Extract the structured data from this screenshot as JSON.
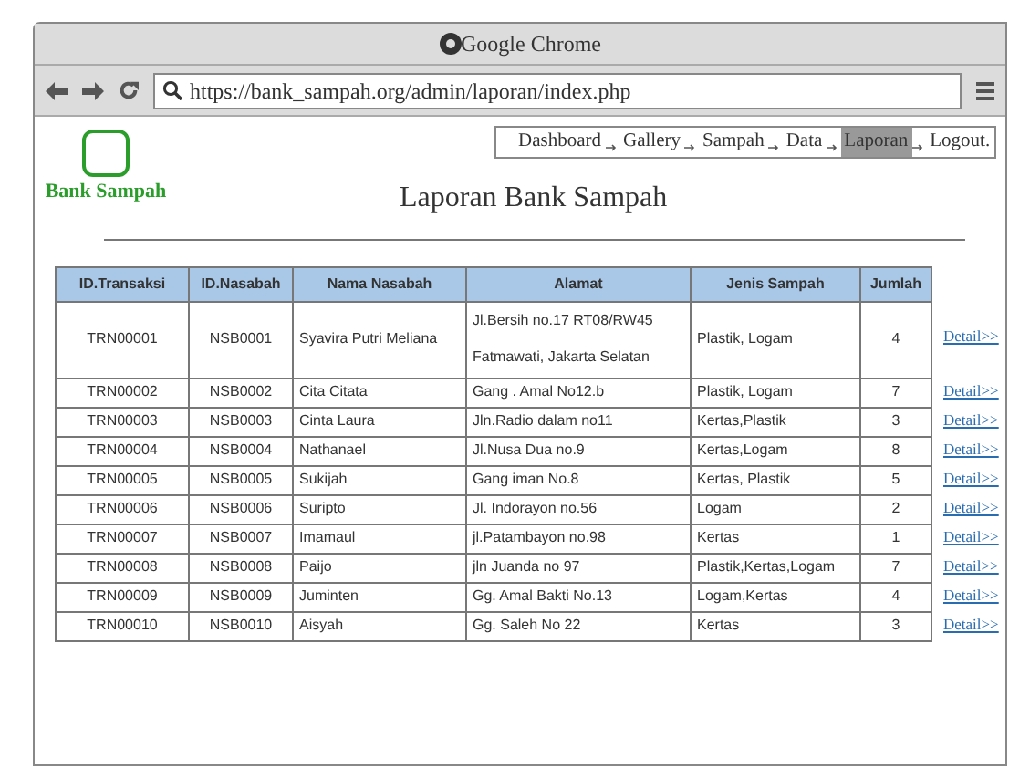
{
  "window": {
    "title": "Google Chrome"
  },
  "address_bar": {
    "url": "https://bank_sampah.org/admin/laporan/index.php"
  },
  "logo": {
    "label": "Bank Sampah"
  },
  "menu": [
    {
      "label": "Dashboard",
      "selected": false
    },
    {
      "label": "Gallery",
      "selected": false
    },
    {
      "label": "Sampah",
      "selected": false
    },
    {
      "label": "Data",
      "selected": false
    },
    {
      "label": "Laporan",
      "selected": true
    },
    {
      "label": "Logout.",
      "selected": false
    }
  ],
  "heading": "Laporan Bank Sampah",
  "table": {
    "columns": [
      "ID.Transaksi",
      "ID.Nasabah",
      "Nama Nasabah",
      "Alamat",
      "Jenis Sampah",
      "Jumlah"
    ],
    "rows": [
      {
        "cells": [
          "TRN00001",
          "NSB0001",
          "Syavira Putri Meliana",
          "Jl.Bersih no.17 RT08/RW45 Fatmawati, Jakarta Selatan",
          "Plastik, Logam",
          "4"
        ],
        "link": "Detail>>"
      },
      {
        "cells": [
          "TRN00002",
          "NSB0002",
          "Cita Citata",
          "Gang . Amal No12.b",
          "Plastik, Logam",
          "7"
        ],
        "link": "Detail>>"
      },
      {
        "cells": [
          "TRN00003",
          "NSB0003",
          "Cinta Laura",
          "Jln.Radio dalam no11",
          "Kertas,Plastik",
          "3"
        ],
        "link": "Detail>>"
      },
      {
        "cells": [
          "TRN00004",
          "NSB0004",
          "Nathanael",
          "Jl.Nusa Dua no.9",
          "Kertas,Logam",
          "8"
        ],
        "link": "Detail>>"
      },
      {
        "cells": [
          "TRN00005",
          "NSB0005",
          "Sukijah",
          "Gang iman No.8",
          "Kertas, Plastik",
          "5"
        ],
        "link": "Detail>>"
      },
      {
        "cells": [
          "TRN00006",
          "NSB0006",
          "Suripto",
          "Jl. Indorayon no.56",
          "Logam",
          "2"
        ],
        "link": "Detail>>"
      },
      {
        "cells": [
          "TRN00007",
          "NSB0007",
          "Imamaul",
          "jl.Patambayon no.98",
          "Kertas",
          "1"
        ],
        "link": "Detail>>"
      },
      {
        "cells": [
          "TRN00008",
          "NSB0008",
          "Paijo",
          "jln Juanda no 97",
          "Plastik,Kertas,Logam",
          "7"
        ],
        "link": "Detail>>"
      },
      {
        "cells": [
          "TRN00009",
          "NSB0009",
          "Juminten",
          "Gg. Amal Bakti No.13",
          "Logam,Kertas",
          "4"
        ],
        "link": "Detail>>"
      },
      {
        "cells": [
          "TRN00010",
          "NSB0010",
          "Aisyah",
          "Gg. Saleh No 22",
          "Kertas",
          "3"
        ],
        "link": "Detail>>"
      }
    ]
  }
}
